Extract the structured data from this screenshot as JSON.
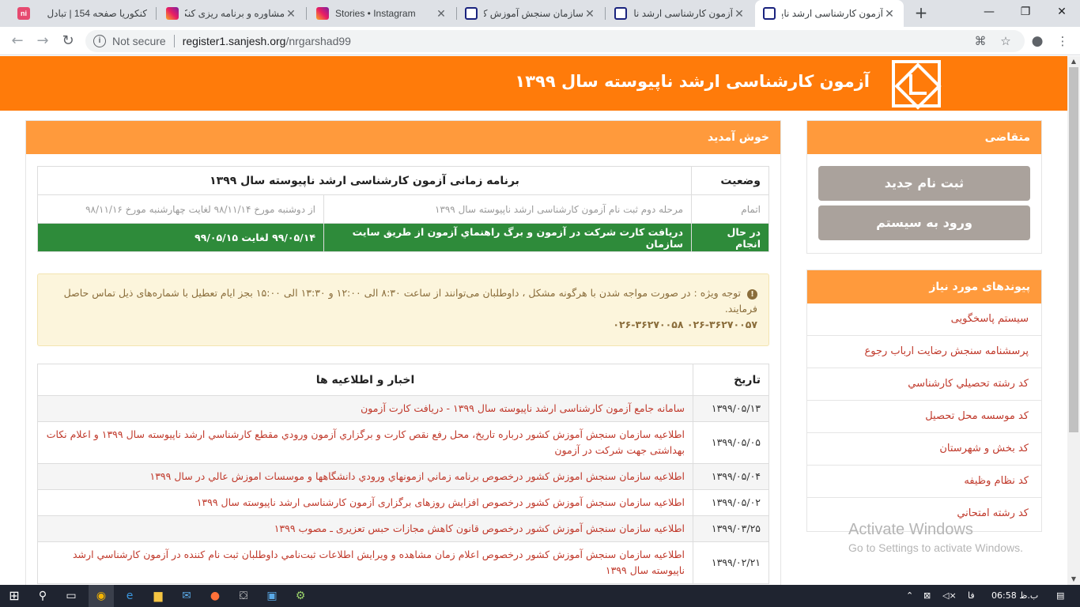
{
  "browser": {
    "tabs": [
      {
        "title": "کنکوریا صفحه 154 | تبادل",
        "icon": "ni-icon"
      },
      {
        "title": "مشاوره و برنامه ریزی کنکور",
        "icon": "instagram-icon"
      },
      {
        "title": "Stories • Instagram",
        "icon": "instagram-icon"
      },
      {
        "title": "سازمان سنجش آموزش کشور",
        "icon": "sanjesh-icon"
      },
      {
        "title": "آزمون کارشناسی ارشد ناپیوسته",
        "icon": "sanjesh-icon"
      },
      {
        "title": "آزمون کارشناسی ارشد ناپیوسته",
        "icon": "sanjesh-icon",
        "active": true
      }
    ],
    "address": {
      "security": "Not secure",
      "host": "register1.sanjesh.org",
      "path": "/nrgarshad99"
    }
  },
  "header": {
    "title": "آزمون کارشناسی ارشد ناپیوسته سال ۱۳۹۹"
  },
  "main": {
    "heading": "خوش آمدید",
    "status_table": {
      "head_status": "وضعیت",
      "head_title": "برنامه زمانی آزمون کارشناسی ارشد ناپیوسته سال ۱۳۹۹",
      "rows": [
        {
          "status": "اتمام",
          "desc": "مرحله دوم ثبت نام آزمون کارشناسی ارشد ناپیوسته سال ۱۳۹۹",
          "date": "از دوشنبه مورخ ۹۸/۱۱/۱۴ لغایت چهارشنبه مورخ ۹۸/۱۱/۱۶"
        },
        {
          "status": "در حال انجام",
          "desc": "دریافت کارت شرکت در آزمون و برگ راهنماي آزمون از طريق سايت سازمان",
          "date": "۹۹/۰۵/۱۴ لغایت ۹۹/۰۵/۱۵"
        }
      ]
    },
    "notice": {
      "text": "توجه ویژه : در صورت مواجه شدن با هرگونه مشکل ، داوطلبان می‌توانند از ساعت ۸:۳۰ الی ۱۲:۰۰ و ۱۳:۳۰ الی ۱۵:۰۰ بجز ایام تعطیل با شماره‌های ذیل تماس حاصل فرمایند.",
      "phones": "۰۲۶-۳۶۲۷۰۰۵۷   ۰۲۶-۳۶۲۷۰۰۵۸"
    },
    "news": {
      "head_date": "تاریخ",
      "head_title": "اخبار و اطلاعیه ها",
      "items": [
        {
          "date": "۱۳۹۹/۰۵/۱۳",
          "title": "سامانه جامع آزمون کارشناسی ارشد ناپیوسته سال ۱۳۹۹ - دریافت کارت آزمون"
        },
        {
          "date": "۱۳۹۹/۰۵/۰۵",
          "title": "اطلاعيه سازمان سنجش آموزش کشور درباره تاریخ، محل رفع نقص کارت و برگزاري آزمون ورودي مقطع کارشناسي ارشد ناپيوسته سال ۱۳۹۹ و اعلام نکات بهداشتی جهت شرکت در آزمون"
        },
        {
          "date": "۱۳۹۹/۰۵/۰۴",
          "title": "اطلاعيه سازمان سنجش اموزش كشور درخصوص برنامه زماني ازمونهاي ورودي دانشگاهها و موسسات اموزش عالي در سال ۱۳۹۹"
        },
        {
          "date": "۱۳۹۹/۰۵/۰۲",
          "title": "اطلاعیه سازمان سنجش آموزش کشور درخصوص افزایش روزهای برگزاری آزمون کارشناسی ارشد ناپیوسته سال ۱۳۹۹"
        },
        {
          "date": "۱۳۹۹/۰۳/۲۵",
          "title": "اطلاعیه سازمان سنجش آموزش کشور درخصوص قانون کاهش مجازات حبس تعزیری ـ مصوب ۱۳۹۹"
        },
        {
          "date": "۱۳۹۹/۰۲/۲۱",
          "title": "اطلاعيه سازمان سنجش آموزش کشور درخصوص اعلام زمان مشاهده و ويرايش اطلاعات ثبت‌نامي داوطلبان ثبت نام کننده در آزمون کارشناسي ارشد ناپيوسته سال ۱۳۹۹"
        }
      ]
    }
  },
  "sidebar": {
    "applicant": {
      "heading": "متقاضی",
      "register_label": "ثبت نام جدید",
      "login_label": "ورود به سیستم"
    },
    "links": {
      "heading": "پیوندهای مورد نیاز",
      "items": [
        "سیستم پاسخگویی",
        "پرسشنامه سنجش رضایت ارباب رجوع",
        "کد رشته تحصيلي كارشناسي",
        "کد موسسه محل تحصيل",
        "کد بخش و شهرستان",
        "کد نظام وظيفه",
        "کد رشته امتحاني"
      ]
    }
  },
  "watermark": {
    "title": "Activate Windows",
    "subtitle": "Go to Settings to activate Windows."
  },
  "taskbar": {
    "lang": "فا",
    "time": "06:58 ب.ظ"
  }
}
